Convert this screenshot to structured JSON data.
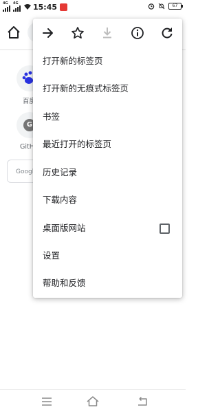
{
  "status_bar": {
    "net1": "4G",
    "net2": "4G",
    "time": "15:45",
    "battery": "67"
  },
  "tiles": [
    {
      "label": "百度"
    },
    {
      "label": "GitH"
    }
  ],
  "search_box": {
    "placeholder": "Googl"
  },
  "menu": {
    "items": [
      {
        "label": "打开新的标签页"
      },
      {
        "label": "打开新的无痕式标签页"
      },
      {
        "label": "书签"
      },
      {
        "label": "最近打开的标签页"
      },
      {
        "label": "历史记录"
      },
      {
        "label": "下载内容"
      },
      {
        "label": "桌面版网站"
      },
      {
        "label": "设置"
      },
      {
        "label": "帮助和反馈"
      }
    ]
  },
  "icons": [
    "home-icon",
    "forward-icon",
    "bookmark-star-icon",
    "download-icon",
    "info-icon",
    "reload-icon",
    "menu-lines-icon",
    "home-nav-icon",
    "back-nav-icon"
  ]
}
